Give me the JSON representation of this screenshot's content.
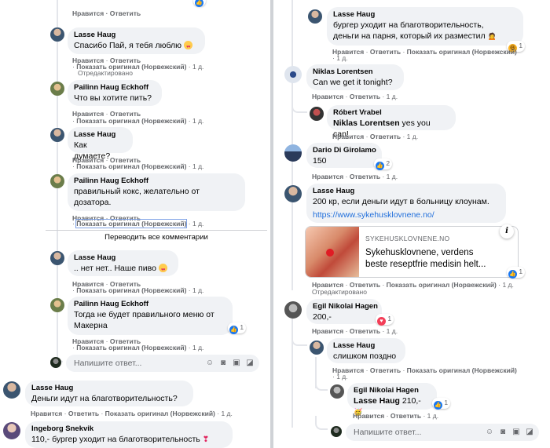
{
  "colors": {
    "bubble": "#f0f2f5",
    "link": "#216fdb",
    "meta": "#65676b",
    "like": "#1877f2"
  },
  "actions": {
    "like": "Нравится",
    "reply": "Ответить",
    "original": "Показать оригинал (Норвежский)",
    "edited": "Отредактировано"
  },
  "reply_placeholder": "Напишите ответ...",
  "left": {
    "top_cut_meta": "Нравится · Ответить",
    "comments": [
      {
        "name": "Lasse Haug",
        "text": "Спасибо Пай, я тебя люблю",
        "time": "1 д.",
        "edited": true
      },
      {
        "name": "Pailinn Haug Eckhoff",
        "text": "Что вы хотите пить?",
        "time": "1 д."
      },
      {
        "name": "Lasse Haug",
        "text": "Как думаете?",
        "time": "1 д."
      },
      {
        "name": "Pailinn Haug Eckhoff",
        "text_line1": "правильный кокс, желательно от",
        "text_line2": "дозатора.",
        "time": "1 д."
      },
      {
        "name": "Lasse Haug",
        "text": ".. нет нет.. Наше пиво",
        "time": "1 д."
      },
      {
        "name": "Pailinn Haug Eckhoff",
        "text_line1": "Тогда не будет правильного меню от",
        "text_line2": "Макерна",
        "time": "1 д.",
        "reactions": "1"
      },
      {
        "name": "Lasse Haug",
        "text": "Деньги идут на благотворительность?",
        "time": "1 д."
      },
      {
        "name": "Ingeborg Snekvik",
        "text": "110,- бургер уходит на благотворительность",
        "time": "1 д."
      }
    ],
    "translate_all": "Переводить все комментарии"
  },
  "right": {
    "comments": [
      {
        "name": "Lasse Haug",
        "text_line1": "бургер уходит на благотворительность,",
        "text_line2": "деньги на парня, который их разместил",
        "time": "1 д.",
        "reactions": "1"
      },
      {
        "name": "Niklas Lorentsen",
        "text": "Can we get it tonight?",
        "time": "1 д."
      },
      {
        "name": "Róbert Vrabel",
        "mention": "Niklas Lorentsen",
        "text": "yes you can!",
        "time": "1 д."
      },
      {
        "name": "Dario Di Girolamo",
        "text": "150",
        "time": "1 д.",
        "reactions": "2"
      },
      {
        "name": "Lasse Haug",
        "text": "200 кр, если деньги идут в больницу клоунам.",
        "link": "https://www.sykehusklovnene.no/",
        "time": "1 д.",
        "edited": true,
        "reactions": "1"
      },
      {
        "name": "Egil Nikolai Hagen",
        "text": "200,-",
        "time": "1 д.",
        "reactions": "1"
      },
      {
        "name": "Lasse Haug",
        "text": "слишком поздно",
        "time": "1 д."
      },
      {
        "name": "Egil Nikolai Hagen",
        "mention": "Lasse Haug",
        "text": "210,-",
        "time": "1 д.",
        "reactions": "1"
      }
    ],
    "preview": {
      "domain": "SYKEHUSKLOVNENE.NO",
      "title_line1": "Sykehusklovnene, verdens",
      "title_line2": "beste reseptfrie medisin helt..."
    }
  }
}
